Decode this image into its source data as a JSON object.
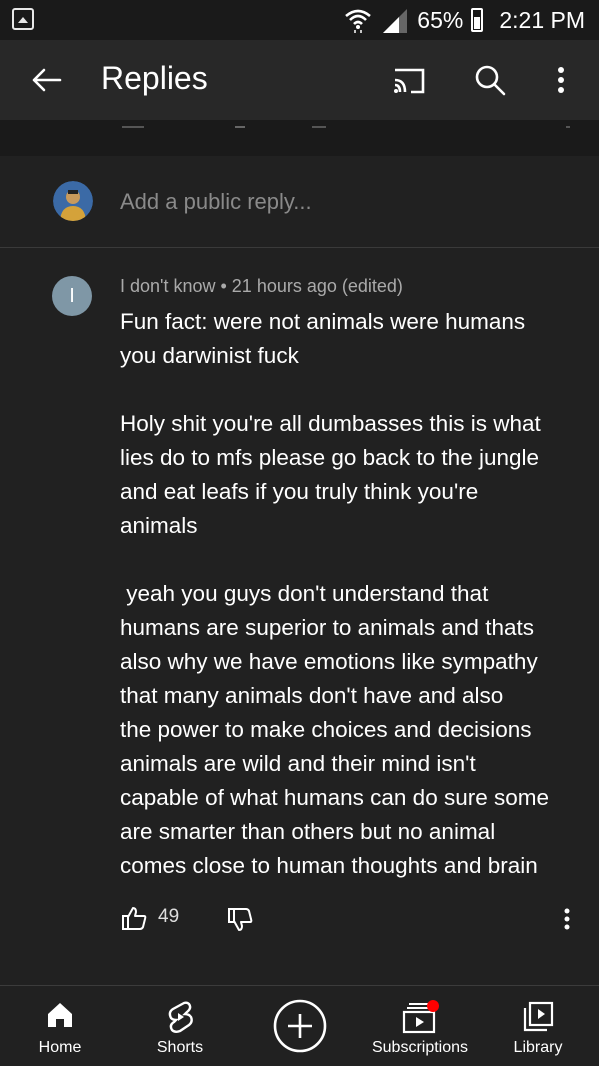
{
  "status_bar": {
    "battery": "65%",
    "time": "2:21 PM"
  },
  "app_bar": {
    "title": "Replies"
  },
  "reply_box": {
    "placeholder": "Add a public reply..."
  },
  "comment": {
    "avatar_letter": "I",
    "meta": "I don't know • 21 hours ago (edited)",
    "text": "Fun fact: were not animals were humans\nyou darwinist fuck\n\nHoly shit you're all dumbasses this is what\nlies do to mfs please go back to the jungle\nand eat leafs if you truly think you're\nanimals\n\n yeah you guys don't understand that\nhumans are superior to animals and thats\nalso why we have emotions like sympathy\nthat many animals don't have and also\nthe power to make choices and decisions\nanimals are wild and their mind isn't\ncapable of what humans can do sure some\nare smarter than others but no animal\ncomes close to human thoughts and brain",
    "likes": "49"
  },
  "bottom_nav": {
    "home": "Home",
    "shorts": "Shorts",
    "subscriptions": "Subscriptions",
    "library": "Library"
  },
  "colors": {
    "background": "#212121",
    "app_bar": "#282828",
    "notification_dot": "#ff0000"
  }
}
